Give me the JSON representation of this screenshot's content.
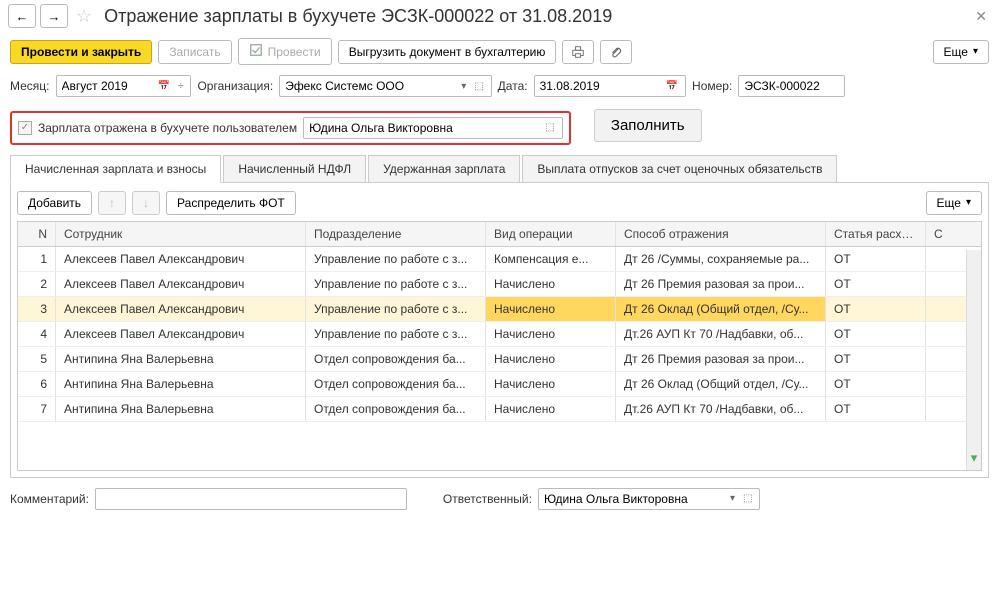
{
  "header": {
    "title": "Отражение зарплаты в бухучете ЭСЗК-000022 от 31.08.2019",
    "close": "✕"
  },
  "toolbar": {
    "post_close": "Провести и закрыть",
    "save": "Записать",
    "post": "Провести",
    "export": "Выгрузить документ в бухгалтерию",
    "more": "Еще"
  },
  "fields": {
    "month_label": "Месяц:",
    "month_value": "Август 2019",
    "org_label": "Организация:",
    "org_value": "Эфекс Системс ООО",
    "date_label": "Дата:",
    "date_value": "31.08.2019",
    "number_label": "Номер:",
    "number_value": "ЭСЗК-000022",
    "reflected_label": "Зарплата отражена в бухучете пользователем",
    "reflected_user": "Юдина Ольга Викторовна",
    "fill": "Заполнить"
  },
  "tabs": {
    "t1": "Начисленная зарплата и взносы",
    "t2": "Начисленный НДФЛ",
    "t3": "Удержанная зарплата",
    "t4": "Выплата отпусков за счет оценочных обязательств"
  },
  "tab_toolbar": {
    "add": "Добавить",
    "distribute": "Распределить ФОТ",
    "more": "Еще"
  },
  "table": {
    "headers": {
      "n": "N",
      "emp": "Сотрудник",
      "dep": "Подразделение",
      "op": "Вид операции",
      "ref": "Способ отражения",
      "art": "Статья расх…",
      "last": "С"
    },
    "rows": [
      {
        "n": "1",
        "emp": "Алексеев Павел Александрович",
        "dep": "Управление по работе с з...",
        "op": "Компенсация е...",
        "ref": "Дт 26  /Суммы, сохраняемые ра...",
        "art": "ОТ"
      },
      {
        "n": "2",
        "emp": "Алексеев Павел Александрович",
        "dep": "Управление по работе с з...",
        "op": "Начислено",
        "ref": "Дт 26  Премия разовая  за прои...",
        "art": "ОТ"
      },
      {
        "n": "3",
        "emp": "Алексеев Павел Александрович",
        "dep": "Управление по работе с з...",
        "op": "Начислено",
        "ref": "Дт 26 Оклад (Общий отдел, /Су...",
        "art": "ОТ",
        "selected": true
      },
      {
        "n": "4",
        "emp": "Алексеев Павел Александрович",
        "dep": "Управление по работе с з...",
        "op": "Начислено",
        "ref": "Дт.26  АУП  Кт 70  /Надбавки, об...",
        "art": "ОТ"
      },
      {
        "n": "5",
        "emp": "Антипина Яна Валерьевна",
        "dep": "Отдел сопровождения ба...",
        "op": "Начислено",
        "ref": "Дт 26  Премия разовая  за прои...",
        "art": "ОТ"
      },
      {
        "n": "6",
        "emp": "Антипина Яна Валерьевна",
        "dep": "Отдел сопровождения ба...",
        "op": "Начислено",
        "ref": "Дт 26 Оклад (Общий отдел, /Су...",
        "art": "ОТ"
      },
      {
        "n": "7",
        "emp": "Антипина Яна Валерьевна",
        "dep": "Отдел сопровождения ба...",
        "op": "Начислено",
        "ref": "Дт.26  АУП  Кт 70  /Надбавки, об...",
        "art": "ОТ"
      }
    ]
  },
  "footer": {
    "comment_label": "Комментарий:",
    "responsible_label": "Ответственный:",
    "responsible_value": "Юдина Ольга Викторовна"
  }
}
